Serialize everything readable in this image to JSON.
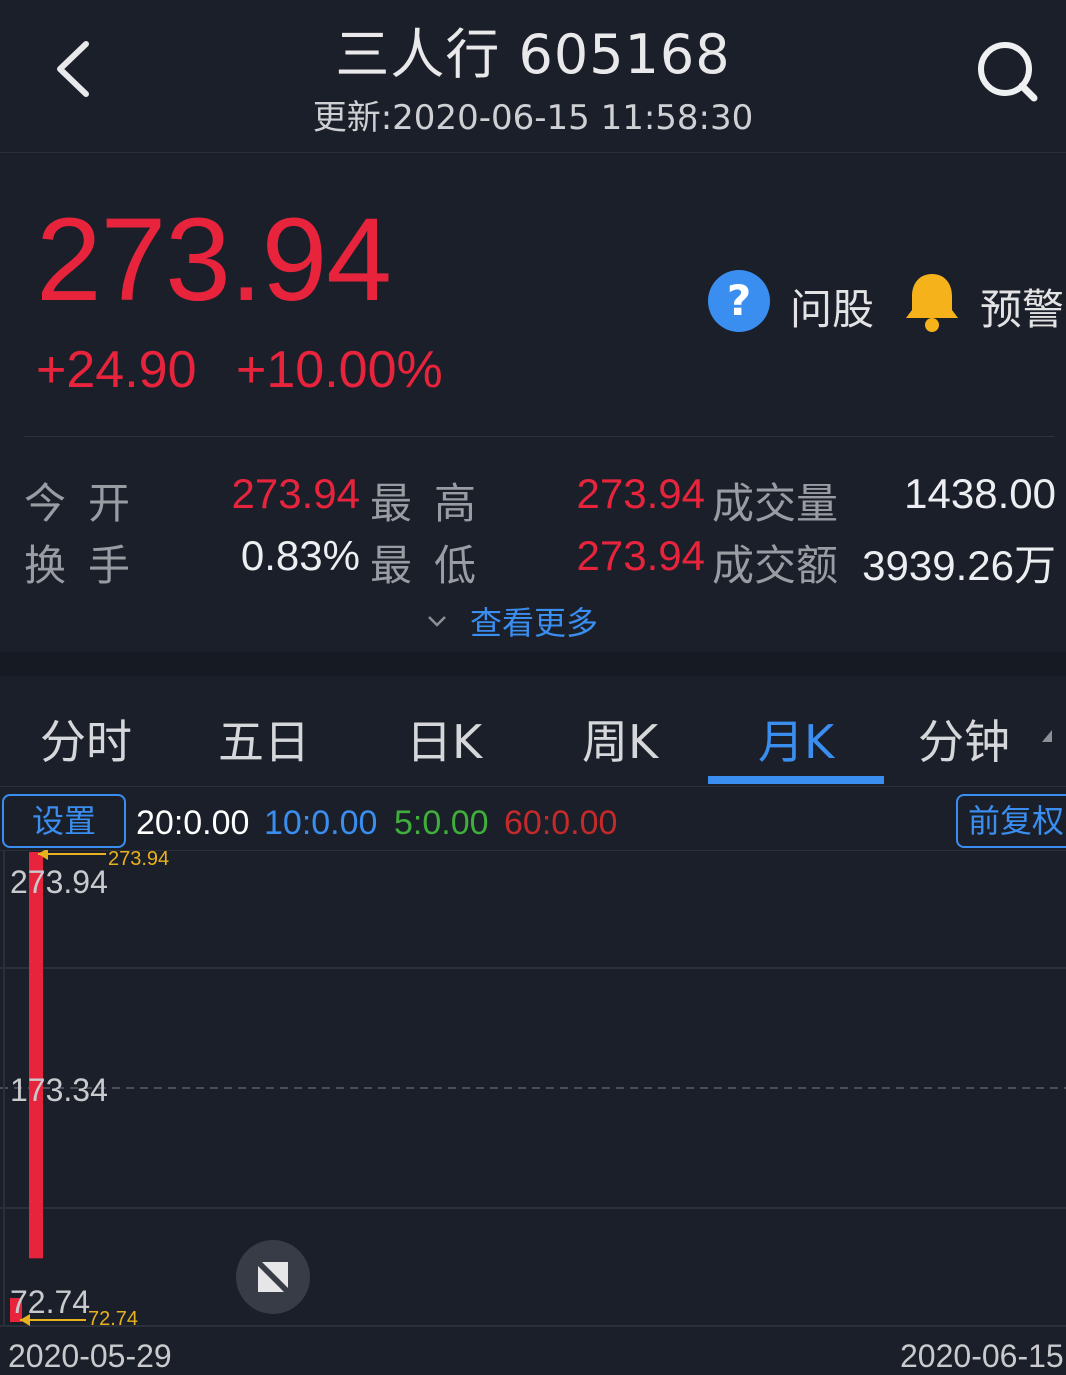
{
  "header": {
    "title": "三人行 605168",
    "updated": "更新:2020-06-15 11:58:30",
    "back_icon": "chevron-left-icon",
    "search_icon": "search-icon"
  },
  "quote": {
    "price": "273.94",
    "change": "+24.90",
    "change_pct": "+10.00%",
    "ask_label": "问股",
    "ask_icon": "question-circle-icon",
    "alert_label": "预警",
    "alert_icon": "bell-icon"
  },
  "stats": {
    "open_label": "今开",
    "open_value": "273.94",
    "turnover_label": "换手",
    "turnover_value": "0.83%",
    "high_label": "最高",
    "high_value": "273.94",
    "low_label": "最低",
    "low_value": "273.94",
    "volume_label": "成交量",
    "volume_value": "1438.00",
    "amount_label": "成交额",
    "amount_value": "3939.26万",
    "more_label": "查看更多"
  },
  "tabs": [
    {
      "label": "分时",
      "active": false
    },
    {
      "label": "五日",
      "active": false
    },
    {
      "label": "日K",
      "active": false
    },
    {
      "label": "周K",
      "active": false
    },
    {
      "label": "月K",
      "active": true
    },
    {
      "label": "分钟",
      "active": false
    }
  ],
  "indicators": {
    "settings_label": "设置",
    "ma20": "20:0.00",
    "ma10": "10:0.00",
    "ma5": "5:0.00",
    "ma60": "60:0.00",
    "adjust_label": "前复权",
    "colors": {
      "ma20": "#ffffff",
      "ma10": "#3a8ef0",
      "ma5": "#3fae3a",
      "ma60": "#c42a2a"
    }
  },
  "chart_data": {
    "type": "candlestick",
    "y_ticks": [
      "273.94",
      "173.34",
      "72.74"
    ],
    "ylim": [
      72.74,
      273.94
    ],
    "x_labels": [
      "2020-05-29",
      "2020-06-15"
    ],
    "max_marker": "273.94",
    "min_marker": "72.74",
    "candles": [
      {
        "open": 72.74,
        "close": 83.0,
        "high": 83.0,
        "low": 72.74
      },
      {
        "open": 273.94,
        "close": 100.0,
        "high": 273.94,
        "low": 100.0
      }
    ],
    "grid": true,
    "colors": {
      "up": "#e8243d",
      "grid": "#2b2f39",
      "marker": "#e8b21e"
    }
  }
}
